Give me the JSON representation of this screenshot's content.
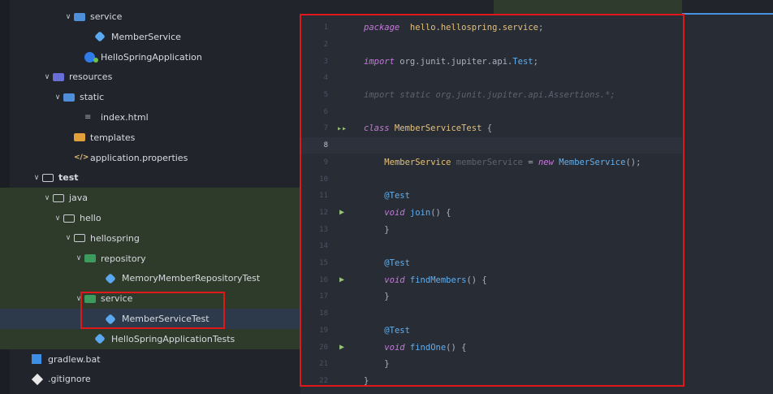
{
  "project_tree": [
    {
      "label": "service",
      "indent": 5,
      "chevron": "open",
      "icon": "package-folder"
    },
    {
      "label": "MemberService",
      "indent": 7,
      "icon": "class"
    },
    {
      "label": "HelloSpringApplication",
      "indent": 6,
      "icon": "spring-app"
    },
    {
      "label": "resources",
      "indent": 3,
      "chevron": "open",
      "icon": "resources-folder"
    },
    {
      "label": "static",
      "indent": 4,
      "chevron": "open",
      "icon": "static-folder"
    },
    {
      "label": "index.html",
      "indent": 6,
      "icon": "html"
    },
    {
      "label": "templates",
      "indent": 5,
      "icon": "templates-folder"
    },
    {
      "label": "application.properties",
      "indent": 5,
      "icon": "properties"
    },
    {
      "label": "test",
      "indent": 2,
      "chevron": "open",
      "icon": "folder",
      "bold": true
    },
    {
      "label": "java",
      "indent": 3,
      "chevron": "open",
      "icon": "folder",
      "highlight": true
    },
    {
      "label": "hello",
      "indent": 4,
      "chevron": "open",
      "icon": "folder",
      "highlight": true
    },
    {
      "label": "hellospring",
      "indent": 5,
      "chevron": "open",
      "icon": "folder",
      "highlight": true
    },
    {
      "label": "repository",
      "indent": 6,
      "chevron": "open",
      "icon": "test-package-folder",
      "highlight": true
    },
    {
      "label": "MemoryMemberRepositoryTest",
      "indent": 8,
      "icon": "test-class",
      "highlight": true
    },
    {
      "label": "service",
      "indent": 6,
      "chevron": "open",
      "icon": "test-package-folder",
      "highlight": true
    },
    {
      "label": "MemberServiceTest",
      "indent": 8,
      "icon": "test-class",
      "selected": true
    },
    {
      "label": "HelloSpringApplicationTests",
      "indent": 7,
      "icon": "test-class",
      "highlight": true
    },
    {
      "label": "gradlew.bat",
      "indent": 1,
      "icon": "windows-bat"
    },
    {
      "label": ".gitignore",
      "indent": 1,
      "icon": "git"
    }
  ],
  "editor": {
    "current_line": 8,
    "lines": [
      {
        "n": "1",
        "tokens": [
          [
            "kw",
            "package"
          ],
          [
            "",
            "  "
          ],
          [
            "pkg",
            "hello.hellospring.service"
          ],
          [
            "",
            ";"
          ]
        ]
      },
      {
        "n": "2",
        "tokens": []
      },
      {
        "n": "3",
        "tokens": [
          [
            "kw",
            "import"
          ],
          [
            "imp",
            " org.junit.jupiter.api."
          ],
          [
            "impt",
            "Test"
          ],
          [
            "",
            ";"
          ]
        ]
      },
      {
        "n": "4",
        "tokens": []
      },
      {
        "n": "5",
        "tokens": [
          [
            "dim",
            "import static org.junit.jupiter.api.Assertions.*;"
          ]
        ]
      },
      {
        "n": "6",
        "tokens": []
      },
      {
        "n": "7",
        "run": "▸▸",
        "tokens": [
          [
            "kw",
            "class"
          ],
          [
            "",
            ""
          ],
          [
            "cls-n",
            " MemberServiceTest"
          ],
          [
            "",
            " {"
          ]
        ]
      },
      {
        "n": "8",
        "tokens": []
      },
      {
        "n": "9",
        "tokens": [
          [
            "",
            "    "
          ],
          [
            "cls-n",
            "MemberService"
          ],
          [
            "var",
            " memberService"
          ],
          [
            "",
            " = "
          ],
          [
            "kw",
            "new"
          ],
          [
            "fn",
            " MemberService"
          ],
          [
            "",
            "();"
          ]
        ]
      },
      {
        "n": "10",
        "tokens": []
      },
      {
        "n": "11",
        "tokens": [
          [
            "",
            "    "
          ],
          [
            "ann",
            "@Test"
          ]
        ]
      },
      {
        "n": "12",
        "run": "▶",
        "tokens": [
          [
            "",
            "    "
          ],
          [
            "kw",
            "void"
          ],
          [
            "fn",
            " join"
          ],
          [
            "",
            "() {"
          ]
        ]
      },
      {
        "n": "13",
        "tokens": [
          [
            "",
            "    }"
          ]
        ]
      },
      {
        "n": "14",
        "tokens": []
      },
      {
        "n": "15",
        "tokens": [
          [
            "",
            "    "
          ],
          [
            "ann",
            "@Test"
          ]
        ]
      },
      {
        "n": "16",
        "run": "▶",
        "tokens": [
          [
            "",
            "    "
          ],
          [
            "kw",
            "void"
          ],
          [
            "fn",
            " findMembers"
          ],
          [
            "",
            "() {"
          ]
        ]
      },
      {
        "n": "17",
        "tokens": [
          [
            "",
            "    }"
          ]
        ]
      },
      {
        "n": "18",
        "tokens": []
      },
      {
        "n": "19",
        "tokens": [
          [
            "",
            "    "
          ],
          [
            "ann",
            "@Test"
          ]
        ]
      },
      {
        "n": "20",
        "run": "▶",
        "tokens": [
          [
            "",
            "    "
          ],
          [
            "kw",
            "void"
          ],
          [
            "fn",
            " findOne"
          ],
          [
            "",
            "() {"
          ]
        ]
      },
      {
        "n": "21",
        "tokens": [
          [
            "",
            "    }"
          ]
        ]
      },
      {
        "n": "22",
        "tokens": [
          [
            "",
            "}"
          ]
        ]
      }
    ]
  },
  "colors": {
    "annotation_box": "#e0171b",
    "test_highlight": "#2e3b2a",
    "editor_bg": "#282c34",
    "sidebar_bg": "#21252b"
  }
}
